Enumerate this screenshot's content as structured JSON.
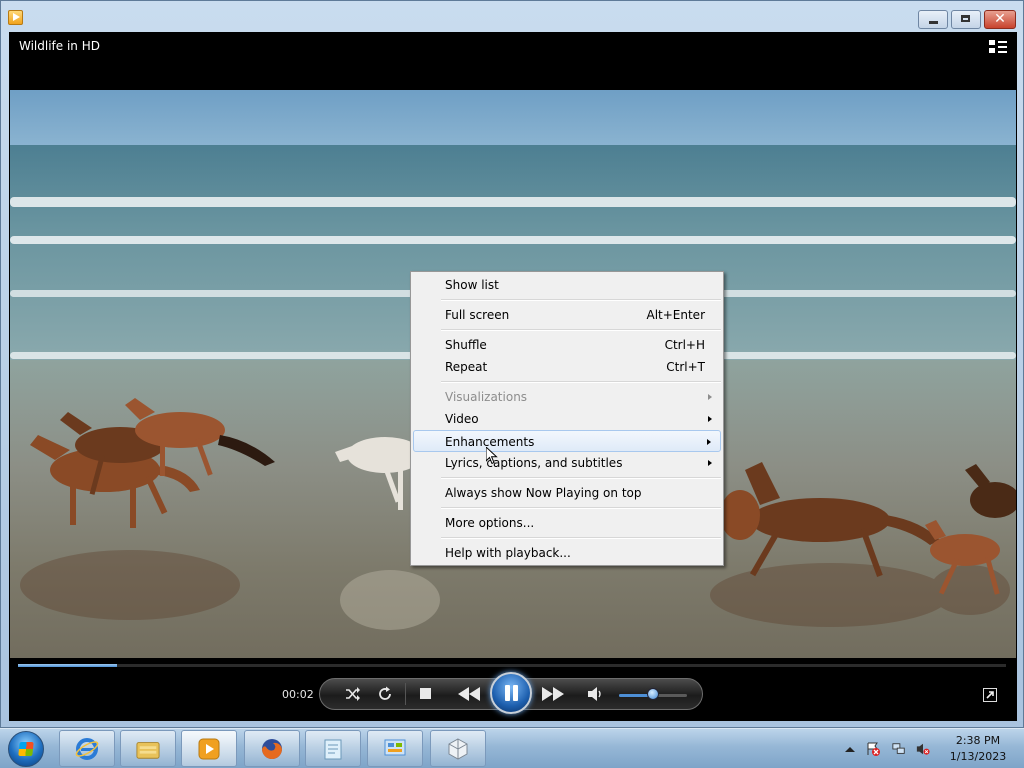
{
  "window": {
    "title": "",
    "controls": {
      "minimize": "minimize",
      "maximize": "maximize",
      "close": "✕"
    }
  },
  "player": {
    "video_title": "Wildlife in HD",
    "time_elapsed": "00:02",
    "seek_progress_fraction": 0.1,
    "volume_fraction": 0.5,
    "icons": {
      "layout": "switch-to-library-icon",
      "shuffle": "shuffle-icon",
      "repeat": "repeat-icon",
      "stop": "stop-icon",
      "previous": "previous-icon",
      "play_pause": "pause-icon",
      "next": "next-icon",
      "mute": "volume-icon",
      "fullscreen": "fullscreen-icon"
    },
    "accent_color": "#3f86d4"
  },
  "context_menu": {
    "items": [
      {
        "label": "Show list",
        "shortcut": "",
        "submenu": false,
        "disabled": false
      },
      {
        "label": "Full screen",
        "shortcut": "Alt+Enter",
        "submenu": false,
        "disabled": false
      },
      {
        "label": "Shuffle",
        "shortcut": "Ctrl+H",
        "submenu": false,
        "disabled": false
      },
      {
        "label": "Repeat",
        "shortcut": "Ctrl+T",
        "submenu": false,
        "disabled": false
      },
      {
        "label": "Visualizations",
        "shortcut": "",
        "submenu": true,
        "disabled": true
      },
      {
        "label": "Video",
        "shortcut": "",
        "submenu": true,
        "disabled": false
      },
      {
        "label": "Enhancements",
        "shortcut": "",
        "submenu": true,
        "disabled": false,
        "highlighted": true
      },
      {
        "label": "Lyrics, captions, and subtitles",
        "shortcut": "",
        "submenu": true,
        "disabled": false
      },
      {
        "label": "Always show Now Playing on top",
        "shortcut": "",
        "submenu": false,
        "disabled": false
      },
      {
        "label": "More options...",
        "shortcut": "",
        "submenu": false,
        "disabled": false
      },
      {
        "label": "Help with playback...",
        "shortcut": "",
        "submenu": false,
        "disabled": false
      }
    ]
  },
  "taskbar": {
    "pinned": [
      {
        "name": "internet-explorer-icon",
        "color": "#2b7bd6"
      },
      {
        "name": "file-explorer-icon",
        "color": "#e8c25a"
      },
      {
        "name": "windows-media-player-icon",
        "color": "#f0a020"
      },
      {
        "name": "firefox-icon",
        "color": "#e66a1f"
      },
      {
        "name": "notepad-icon",
        "color": "#9ecbe6"
      },
      {
        "name": "control-panel-icon",
        "color": "#4d8fd6"
      },
      {
        "name": "virtualbox-icon",
        "color": "#cfd6de"
      }
    ],
    "tray": {
      "time": "2:38 PM",
      "date": "1/13/2023",
      "icons": [
        "show-hidden-icons-icon",
        "action-center-flag-icon",
        "network-icon",
        "volume-muted-icon"
      ]
    }
  }
}
